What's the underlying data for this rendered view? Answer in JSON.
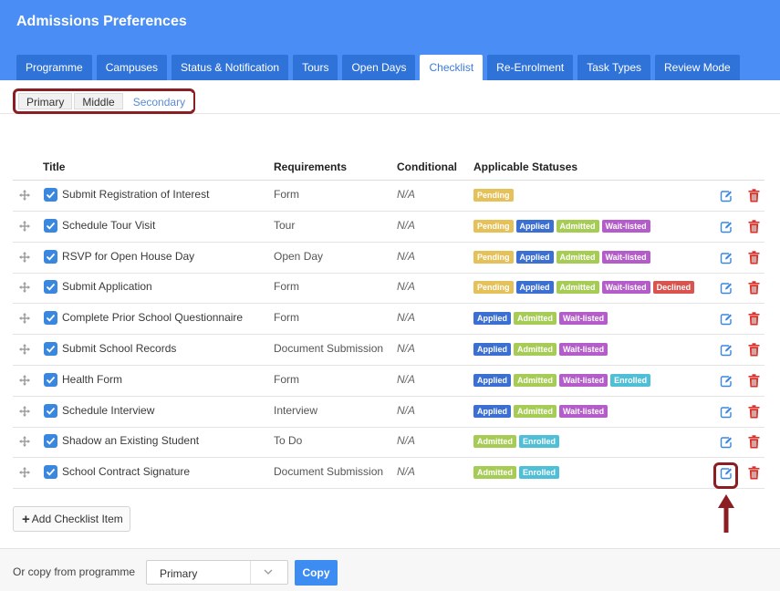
{
  "header": {
    "title": "Admissions Preferences"
  },
  "tabs": [
    {
      "label": "Programme"
    },
    {
      "label": "Campuses"
    },
    {
      "label": "Status & Notification"
    },
    {
      "label": "Tours"
    },
    {
      "label": "Open Days"
    },
    {
      "label": "Checklist"
    },
    {
      "label": "Re-Enrolment"
    },
    {
      "label": "Task Types"
    },
    {
      "label": "Review Mode"
    }
  ],
  "active_tab": "Checklist",
  "subtabs": [
    {
      "label": "Primary"
    },
    {
      "label": "Middle"
    },
    {
      "label": "Secondary"
    }
  ],
  "active_subtab": "Secondary",
  "table": {
    "headers": {
      "title": "Title",
      "requirements": "Requirements",
      "conditional": "Conditional",
      "statuses": "Applicable Statuses"
    },
    "rows": [
      {
        "title": "Submit Registration of Interest",
        "requirement": "Form",
        "conditional": "N/A",
        "statuses": [
          "Pending"
        ]
      },
      {
        "title": "Schedule Tour Visit",
        "requirement": "Tour",
        "conditional": "N/A",
        "statuses": [
          "Pending",
          "Applied",
          "Admitted",
          "Wait-listed"
        ]
      },
      {
        "title": "RSVP for Open House Day",
        "requirement": "Open Day",
        "conditional": "N/A",
        "statuses": [
          "Pending",
          "Applied",
          "Admitted",
          "Wait-listed"
        ]
      },
      {
        "title": "Submit Application",
        "requirement": "Form",
        "conditional": "N/A",
        "statuses": [
          "Pending",
          "Applied",
          "Admitted",
          "Wait-listed",
          "Declined"
        ]
      },
      {
        "title": "Complete Prior School Questionnaire",
        "requirement": "Form",
        "conditional": "N/A",
        "statuses": [
          "Applied",
          "Admitted",
          "Wait-listed"
        ]
      },
      {
        "title": "Submit School Records",
        "requirement": "Document Submission",
        "conditional": "N/A",
        "statuses": [
          "Applied",
          "Admitted",
          "Wait-listed"
        ]
      },
      {
        "title": "Health Form",
        "requirement": "Form",
        "conditional": "N/A",
        "statuses": [
          "Applied",
          "Admitted",
          "Wait-listed",
          "Enrolled"
        ]
      },
      {
        "title": "Schedule Interview",
        "requirement": "Interview",
        "conditional": "N/A",
        "statuses": [
          "Applied",
          "Admitted",
          "Wait-listed"
        ]
      },
      {
        "title": "Shadow an Existing Student",
        "requirement": "To Do",
        "conditional": "N/A",
        "statuses": [
          "Admitted",
          "Enrolled"
        ]
      },
      {
        "title": "School Contract Signature",
        "requirement": "Document Submission",
        "conditional": "N/A",
        "statuses": [
          "Admitted",
          "Enrolled"
        ]
      }
    ]
  },
  "status_colors": {
    "Pending": "#e5c15a",
    "Applied": "#3b6fd1",
    "Admitted": "#a6cc55",
    "Wait-listed": "#b45cc9",
    "Declined": "#d9534f",
    "Enrolled": "#4fbfd8"
  },
  "colors": {
    "header": "#4a8ef5",
    "tab": "#2f72d8",
    "checkbox": "#3a87e0",
    "edit_icon": "#3a87e0",
    "delete_icon": "#d9302a",
    "highlight": "#8b1e22"
  },
  "icons": {
    "drag": "move-icon",
    "edit": "edit-icon",
    "delete": "trash-icon",
    "add": "plus-icon",
    "select": "chevron-down-icon"
  },
  "add_button": {
    "label": "Add Checklist Item"
  },
  "footer": {
    "label": "Or copy from programme",
    "select_value": "Primary",
    "copy_label": "Copy"
  }
}
